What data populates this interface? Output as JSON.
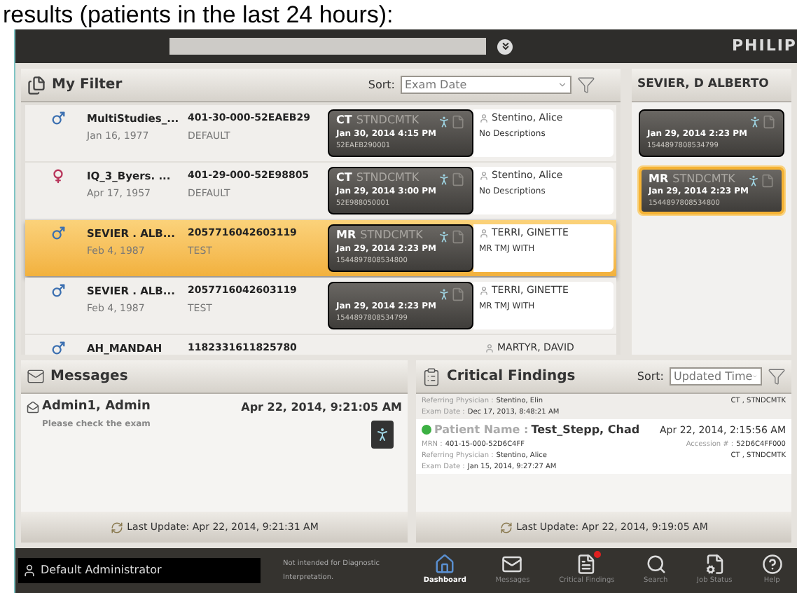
{
  "caption": "results (patients in the last 24 hours):",
  "top_bar": {
    "logo": "PHILIP"
  },
  "filter": {
    "title": "My Filter",
    "sort_label": "Sort:",
    "sort_value": "Exam Date"
  },
  "patients": [
    {
      "kind": "male",
      "selected": false,
      "name": "MultiStudies_...",
      "dob": "Jan 16, 1977",
      "id": "401-30-000-52EAEB29",
      "group": "DEFAULT",
      "study": {
        "modality": "CT",
        "description": "STNDCMTK",
        "date": "Jan 30, 2014 4:15 PM",
        "accession": "52EAEB290001"
      },
      "physician": "Stentino, Alice",
      "note": "No Descriptions"
    },
    {
      "kind": "female",
      "selected": false,
      "name": "IQ_3_Byers. ...",
      "dob": "Apr 17, 1957",
      "id": "401-29-000-52E98805",
      "group": "DEFAULT",
      "study": {
        "modality": "CT",
        "description": "STNDCMTK",
        "date": "Jan 29, 2014 3:00 PM",
        "accession": "52E988050001"
      },
      "physician": "Stentino, Alice",
      "note": "No Descriptions"
    },
    {
      "kind": "male",
      "selected": true,
      "name": "SEVIER . ALB...",
      "dob": "Feb 4, 1987",
      "id": "2057716042603119",
      "group": "TEST",
      "study": {
        "modality": "MR",
        "description": "STNDCMTK",
        "date": "Jan 29, 2014 2:23 PM",
        "accession": "1544897808534800"
      },
      "physician": "TERRI, GINETTE",
      "note": "MR TMJ WITH"
    },
    {
      "kind": "male",
      "selected": false,
      "name": "SEVIER . ALB...",
      "dob": "Feb 4, 1987",
      "id": "2057716042603119",
      "group": "TEST",
      "study": {
        "date": "Jan 29, 2014 2:23 PM",
        "accession": "1544897808534799"
      },
      "physician": "TERRI, GINETTE",
      "note": "MR TMJ WITH"
    },
    {
      "kind": "male",
      "selected": false,
      "name": "AH_MANDAH",
      "id": "1182331611825780",
      "physician": "MARTYR, DAVID"
    }
  ],
  "detail": {
    "title": "SEVIER, D ALBERTO",
    "studies": [
      {
        "selected": false,
        "date": "Jan 29, 2014 2:23 PM",
        "accession": "1544897808534799"
      },
      {
        "selected": true,
        "modality": "MR",
        "description": "STNDCMTK",
        "date": "Jan 29, 2014 2:23 PM",
        "accession": "1544897808534800"
      }
    ]
  },
  "messages": {
    "title": "Messages",
    "items": [
      {
        "sender": "Admin1, Admin",
        "time": "Apr 22, 2014, 9:21:05 AM",
        "text": "Please check the exam"
      }
    ],
    "last_update": "Last Update: Apr 22, 2014, 9:21:31 AM"
  },
  "critical_findings": {
    "title": "Critical Findings",
    "sort_label": "Sort:",
    "sort_value": "Updated Time",
    "items": [
      {
        "lines": [
          {
            "label": "Referring Physician :",
            "value": "Stentino, Elin",
            "right": "CT , STNDCMTK"
          },
          {
            "label": "Exam Date :",
            "value": "Dec 17, 2013, 8:48:21 AM"
          }
        ]
      },
      {
        "color": "#3cb043",
        "patient_label": "Patient Name :",
        "patient": "Test_Stepp, Chad",
        "time": "Apr 22, 2014, 2:15:56 AM",
        "lines": [
          {
            "label": "MRN :",
            "value": "401-15-000-52D6C4FF",
            "right_label": "Accession # :",
            "right": "52D6C4FF000"
          },
          {
            "label": "Referring Physician :",
            "value": "Stentino, Alice",
            "right": "CT , STNDCMTK"
          },
          {
            "label": "Exam Date :",
            "value": "Jan 15, 2014, 9:27:27 AM"
          }
        ]
      }
    ],
    "last_update": "Last Update: Apr 22, 2014, 9:19:05 AM"
  },
  "taskbar": {
    "user": "Default Administrator",
    "notice": "Not intended for Diagnostic Interpretation.",
    "items": [
      {
        "kind": "dashboard",
        "label": "Dashboard",
        "selected": true
      },
      {
        "kind": "messages",
        "label": "Messages",
        "selected": false
      },
      {
        "kind": "findings",
        "label": "Critical Findings",
        "selected": false,
        "alert": true
      },
      {
        "kind": "search",
        "label": "Search",
        "selected": false
      },
      {
        "kind": "jobs",
        "label": "Job Status",
        "selected": false
      },
      {
        "kind": "help",
        "label": "Help",
        "selected": false
      }
    ]
  }
}
